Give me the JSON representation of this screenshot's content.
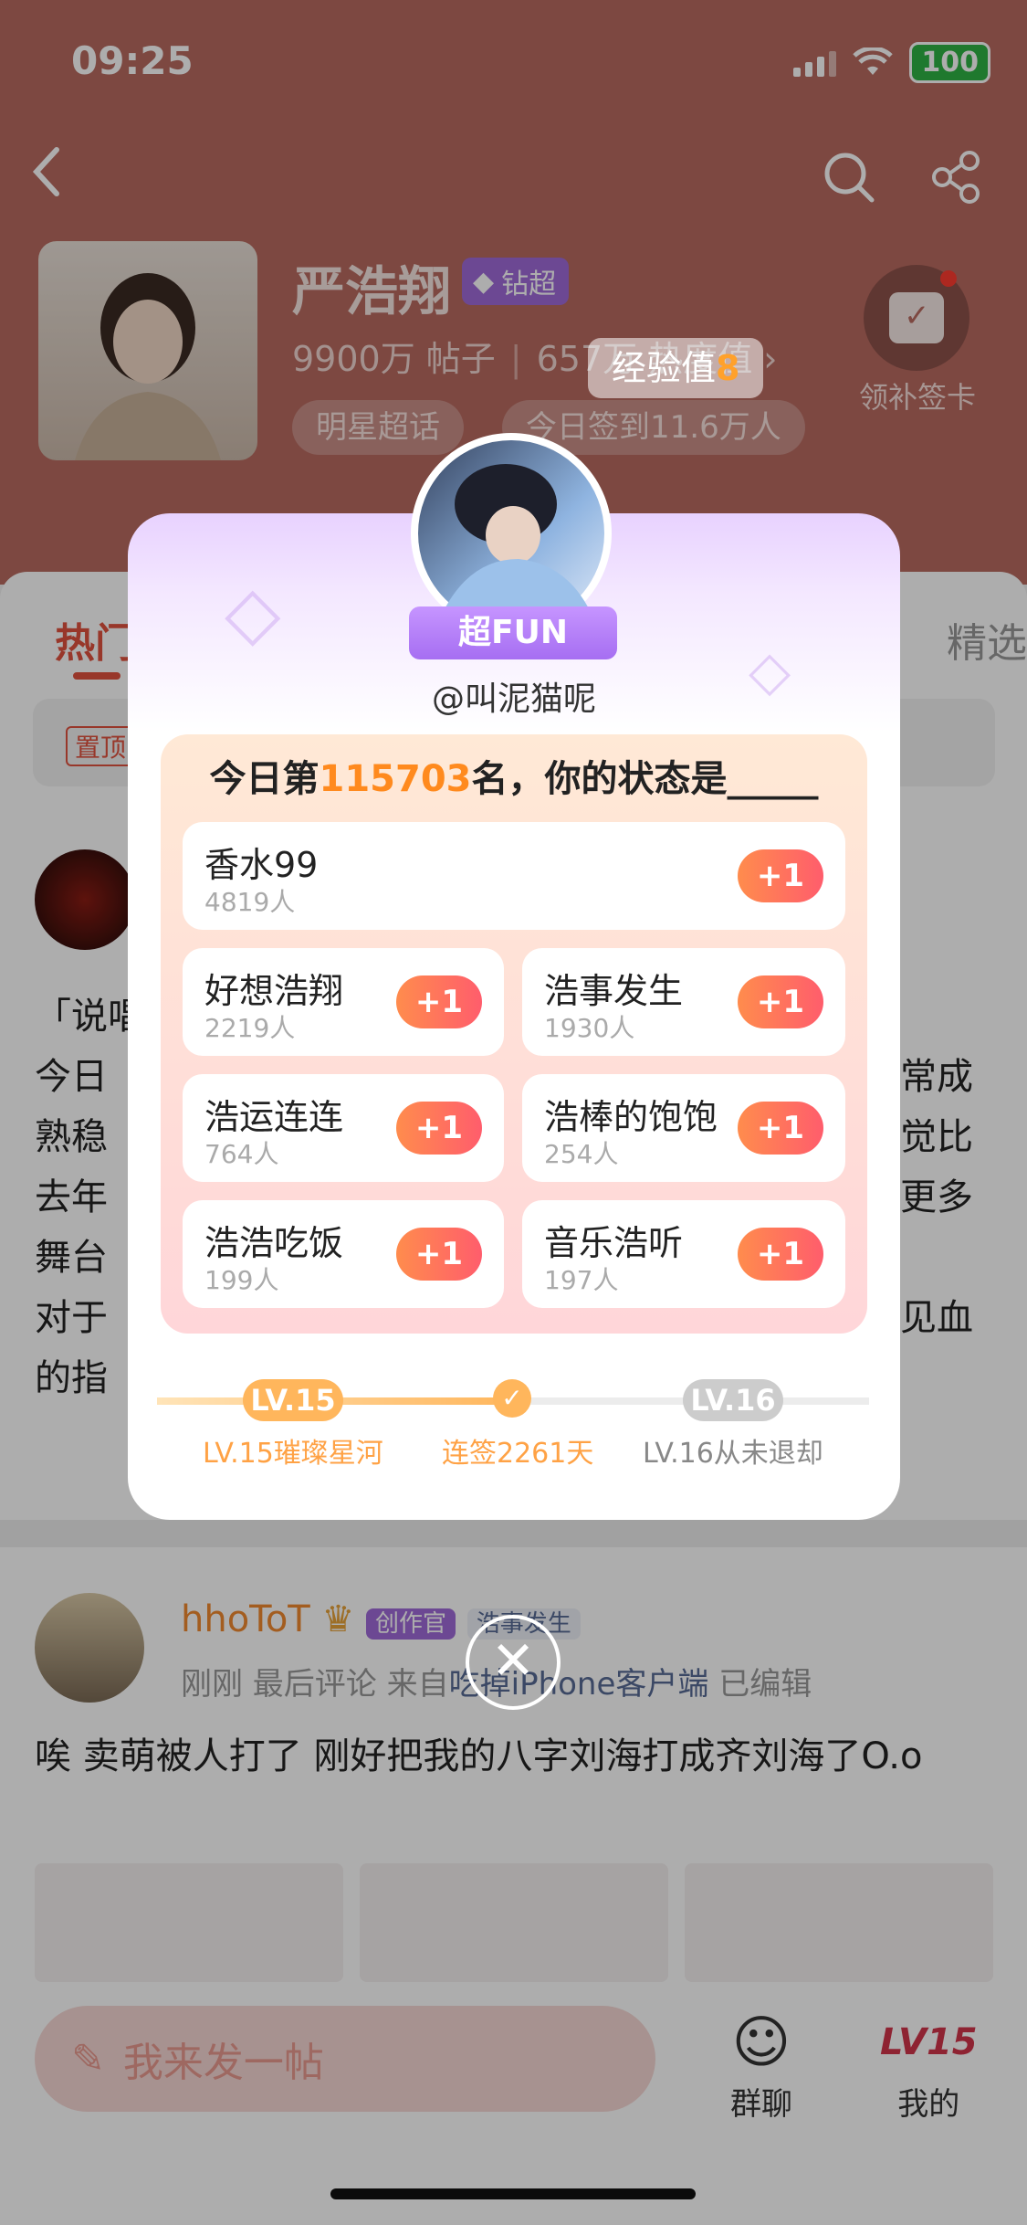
{
  "status_bar": {
    "time": "09:25",
    "battery": "100"
  },
  "header": {
    "topic_name": "严浩翔",
    "badge": "钻超",
    "posts": "9900万 帖子",
    "heat": "657万 热度值 ›",
    "chip1": "明星超话",
    "chip2": "今日签到11.6万人",
    "sign_label": "领补签卡",
    "exp_label": "经验值",
    "exp_value": "8"
  },
  "tabs": {
    "hot": "热门",
    "selected": "精选"
  },
  "filter": {
    "pin": "置顶"
  },
  "post1": {
    "text": "「说唱\n今日\n熟稳\n去年\n舞台\n对于\n的指",
    "right_text": "常成\n觉比\n更多\n\n见血"
  },
  "post2": {
    "name": "hhoToT",
    "creator_badge": "创作官",
    "topic_badge": "浩事发生",
    "meta_prefix": "刚刚 最后评论  来自",
    "meta_source": "吃掉iPhone客户端",
    "meta_suffix": "已编辑",
    "text": "唉 卖萌被人打了 刚好把我的八字刘海打成齐刘海了O.o"
  },
  "bottom_bar": {
    "post_placeholder": "我来发一帖",
    "group": "群聊",
    "mine": "我的",
    "level": "LV15"
  },
  "modal": {
    "fun_label": "超FUN",
    "username": "@叫泥猫呢",
    "rank_prefix": "今日第",
    "rank_number": "115703",
    "rank_suffix": "名，你的状态是_____",
    "plus_label": "+1",
    "options": [
      {
        "name": "香水99",
        "count": "4819人"
      },
      {
        "name": "好想浩翔",
        "count": "2219人"
      },
      {
        "name": "浩事发生",
        "count": "1930人"
      },
      {
        "name": "浩运连连",
        "count": "764人"
      },
      {
        "name": "浩棒的饱饱",
        "count": "254人"
      },
      {
        "name": "浩浩吃饭",
        "count": "199人"
      },
      {
        "name": "音乐浩听",
        "count": "197人"
      }
    ],
    "level_current": "LV.15",
    "level_next": "LV.16",
    "level_current_label": "LV.15璀璨星河",
    "streak_label": "连签2261天",
    "level_next_label": "LV.16从未退却",
    "close": "✕"
  }
}
